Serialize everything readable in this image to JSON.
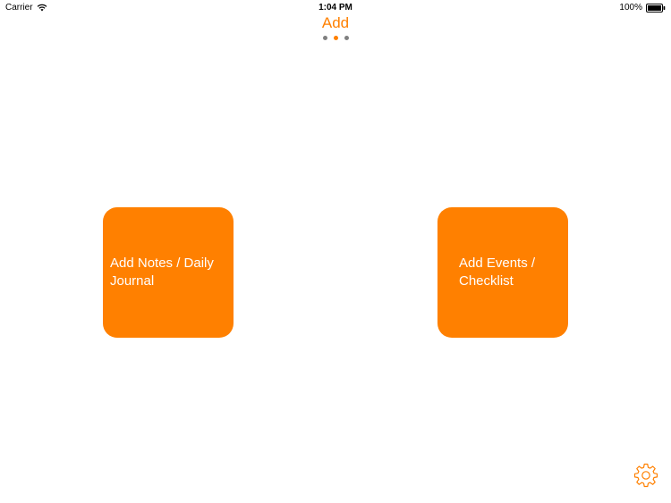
{
  "status_bar": {
    "carrier": "Carrier",
    "time": "1:04 PM",
    "battery": "100%"
  },
  "header": {
    "title": "Add",
    "page_indicator": {
      "pages": 3,
      "current_page": 2
    }
  },
  "tiles": [
    {
      "label": "Add Notes / Daily Journal"
    },
    {
      "label": "Add Events / Checklist"
    }
  ],
  "settings": {
    "icon": "gear-icon"
  },
  "colors": {
    "accent": "#ff8000",
    "dot_inactive": "#808080",
    "background": "#ffffff"
  }
}
